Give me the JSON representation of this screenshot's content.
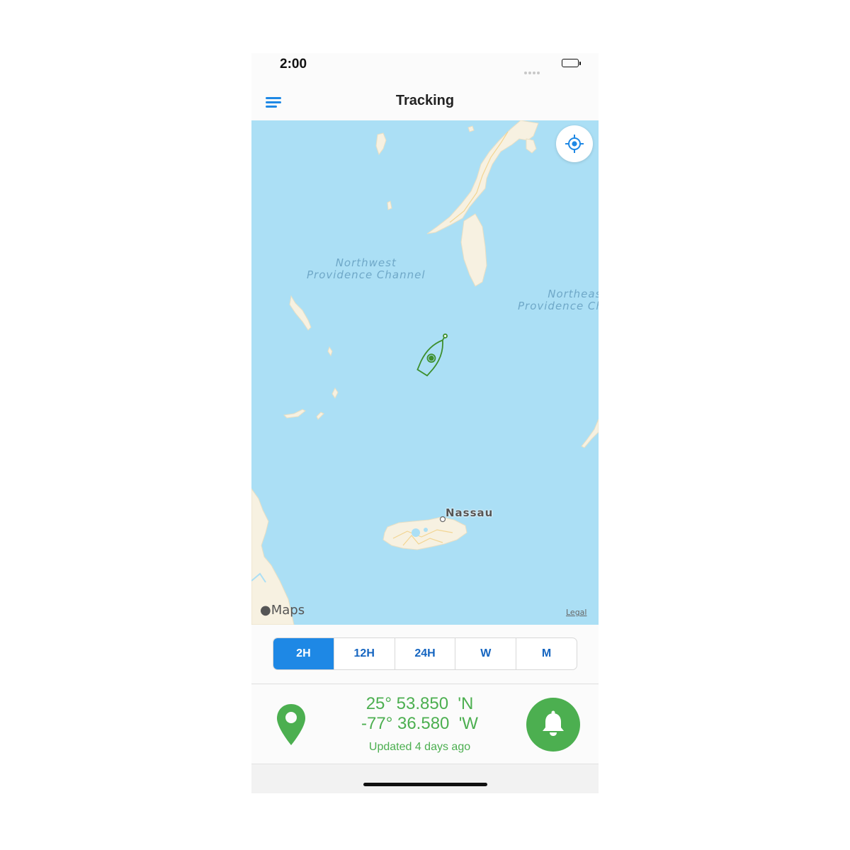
{
  "status_bar": {
    "time": "2:00"
  },
  "nav": {
    "title": "Tracking",
    "menu_icon": "hamburger-menu-icon"
  },
  "map": {
    "sea_labels": {
      "northwest": "Northwest\nProvidence Channel",
      "northeast": "Northeast\nProvidence Channel"
    },
    "city_label": "Nassau",
    "attribution": "Maps",
    "legal": "Legal",
    "water_color": "#abdff5",
    "land_color": "#f7f1e1",
    "marker_color": "#3d8f2e"
  },
  "time_ranges": {
    "selected": "2H",
    "options": [
      "2H",
      "12H",
      "24H",
      "W",
      "M"
    ]
  },
  "position": {
    "latitude": "25° 53.850  'N",
    "longitude": "-77° 36.580  'W",
    "updated": "Updated 4 days ago"
  },
  "colors": {
    "accent": "#1e88e5",
    "status_green": "#4caf50"
  }
}
